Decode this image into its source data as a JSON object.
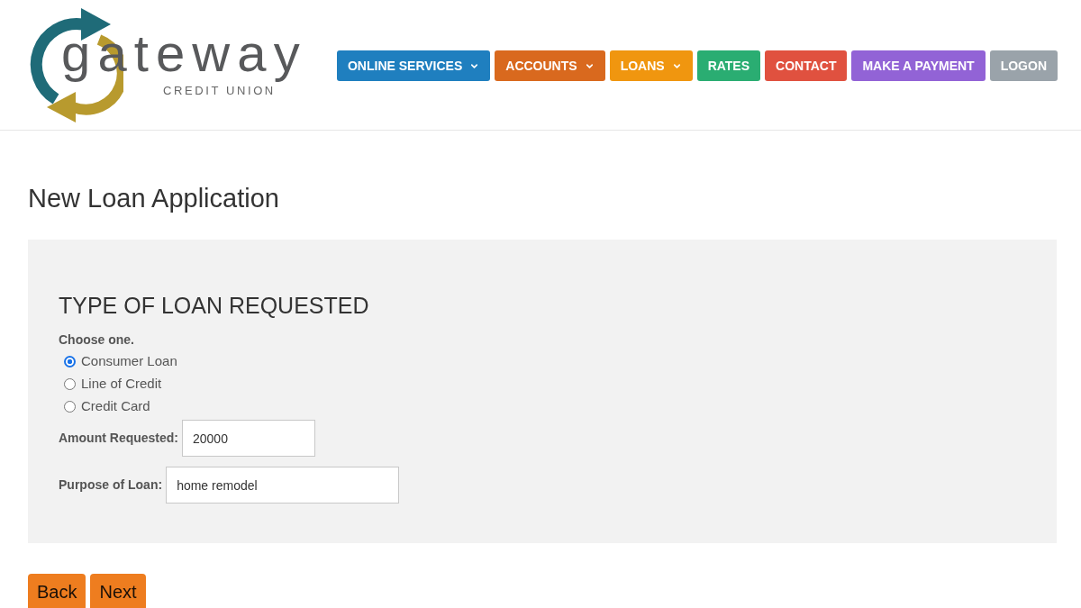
{
  "logo": {
    "wordmark": "gateway",
    "tagline": "CREDIT UNION"
  },
  "nav": [
    {
      "label": "ONLINE SERVICES",
      "dropdown": true,
      "color": "#1f7fbf"
    },
    {
      "label": "ACCOUNTS",
      "dropdown": true,
      "color": "#d9691e"
    },
    {
      "label": "LOANS",
      "dropdown": true,
      "color": "#f0960f"
    },
    {
      "label": "RATES",
      "dropdown": false,
      "color": "#2aad72"
    },
    {
      "label": "CONTACT",
      "dropdown": false,
      "color": "#e0513f"
    },
    {
      "label": "MAKE A PAYMENT",
      "dropdown": false,
      "color": "#9263d6"
    },
    {
      "label": "LOGON",
      "dropdown": false,
      "color": "#9aa3aa"
    }
  ],
  "page_title": "New Loan Application",
  "form": {
    "section_title": "TYPE OF LOAN REQUESTED",
    "prompt": "Choose one.",
    "options": [
      {
        "label": "Consumer Loan",
        "selected": true
      },
      {
        "label": "Line of Credit",
        "selected": false
      },
      {
        "label": "Credit Card",
        "selected": false
      }
    ],
    "fields": [
      {
        "label": "Amount Requested:",
        "value": "20000"
      },
      {
        "label": "Purpose of Loan:",
        "value": "home remodel"
      }
    ]
  },
  "buttons": [
    "Back",
    "Next"
  ]
}
